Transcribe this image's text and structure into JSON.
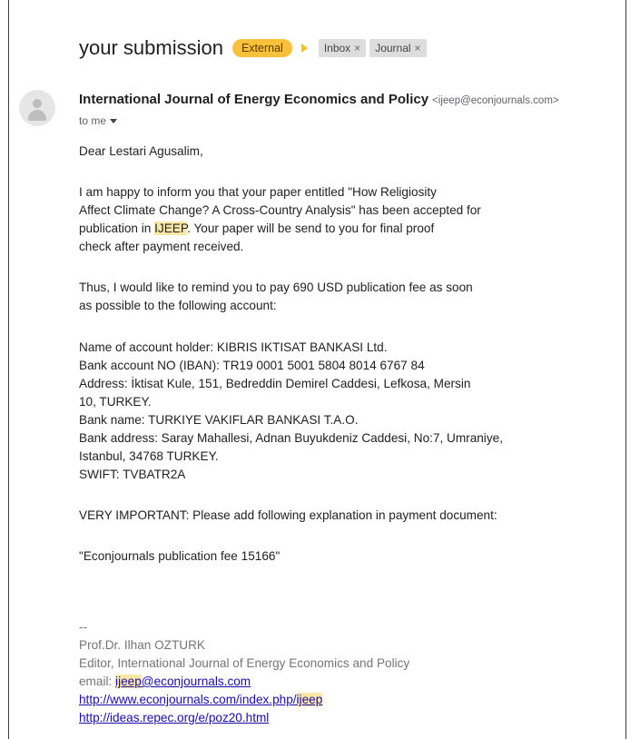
{
  "email": {
    "subject": "your submission",
    "labels": {
      "external": "External",
      "chips": [
        {
          "label": "Inbox",
          "remove": "×"
        },
        {
          "label": "Journal",
          "remove": "×"
        }
      ]
    },
    "sender": {
      "name": "International Journal of Energy Economics and Policy",
      "email": "<ijeep@econjournals.com>",
      "recipient": "to me"
    },
    "body": {
      "greeting": "Dear Lestari Agusalim,",
      "p1_l1": "I am happy to inform you that your paper entitled \"How Religiosity",
      "p1_l2": "Affect Climate Change? A Cross-Country Analysis\" has been accepted for",
      "p1_l3_pre": "publication in ",
      "p1_l3_hl": "IJEEP",
      "p1_l3_post": ". Your paper will be send to you for final proof",
      "p1_l4": "check after payment received.",
      "p2_l1": "Thus, I would like to remind you to pay 690 USD publication fee as soon",
      "p2_l2": "as possible to the following account:",
      "acct_l1": "Name of account holder: KIBRIS IKTISAT BANKASI Ltd.",
      "acct_l2": "Bank account NO (IBAN): TR19 0001 5001 5804 8014 6767 84",
      "acct_l3": "Address: İktisat Kule, 151, Bedreddin Demirel Caddesi, Lefkosa, Mersin",
      "acct_l4": "10, TURKEY.",
      "acct_l5": "Bank name: TURKIYE VAKIFLAR BANKASI T.A.O.",
      "acct_l6": "Bank address: Saray Mahallesi, Adnan Buyukdeniz Caddesi, No:7, Umraniye,",
      "acct_l7": "Istanbul, 34768 TURKEY.",
      "acct_l8": "SWIFT: TVBATR2A",
      "important": "VERY IMPORTANT: Please add following explanation in payment document:",
      "quote": "\"Econjournals publication fee 15166\""
    },
    "signature": {
      "sep": "--",
      "name": "Prof.Dr. Ilhan OZTURK",
      "title": "Editor, International Journal of Energy Economics and Policy",
      "email_label": "email: ",
      "email_hl": "ijeep",
      "email_rest": "@econjournals.com",
      "link1_pre": "http://www.econjournals.com/index.php/",
      "link1_hl": "ijeep",
      "link2": "http://ideas.repec.org/e/poz20.html"
    }
  }
}
